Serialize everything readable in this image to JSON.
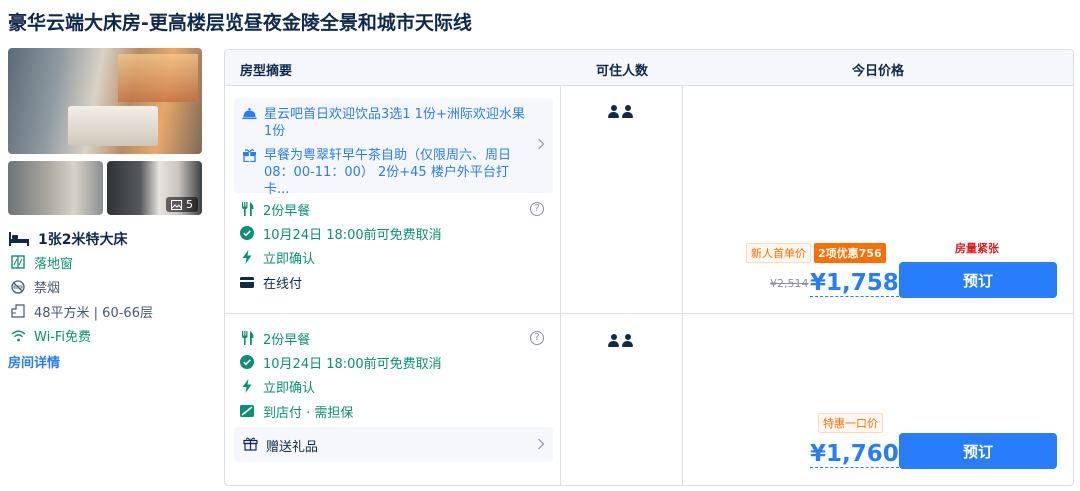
{
  "room": {
    "title": "豪华云端大床房-更高楼层览昼夜金陵全景和城市天际线",
    "photo_count": "5",
    "bed_type": "1张2米特大床",
    "facts": [
      {
        "icon": "window-icon",
        "text": "落地窗",
        "color": "#0a8f73"
      },
      {
        "icon": "no-smoking-icon",
        "text": "禁烟",
        "color": "#455873"
      },
      {
        "icon": "area-icon",
        "text": "48平方米 | 60-66层",
        "color": "#455873"
      },
      {
        "icon": "wifi-icon",
        "text": "Wi-Fi免费",
        "color": "#0a8f73"
      }
    ],
    "detail_link": "房间详情"
  },
  "table": {
    "headers": {
      "summary": "房型摘要",
      "guests": "可住人数",
      "price": "今日价格"
    }
  },
  "rate1": {
    "perks": [
      {
        "icon": "cloche-icon",
        "text": "星云吧首日欢迎饮品3选1 1份+洲际欢迎水果1份"
      },
      {
        "icon": "gift-icon",
        "text": "早餐为粤翠轩早午茶自助（仅限周六、周日08：00-11：00） 2份+45 楼户外平台打卡..."
      }
    ],
    "breakfast": "2份早餐",
    "cancel": "10月24日 18:00前可免费取消",
    "confirm": "立即确认",
    "payment": "在线付",
    "tag_new": "新人首单价",
    "tag_discount": "2项优惠756",
    "original_price": "¥2,514",
    "price": "¥1,758",
    "scarcity": "房量紧张",
    "book": "预订"
  },
  "rate2": {
    "breakfast": "2份早餐",
    "cancel": "10月24日 18:00前可免费取消",
    "confirm": "立即确认",
    "payment": "到店付 · 需担保",
    "gift": "赠送礼品",
    "tag": "特惠一口价",
    "price": "¥1,760",
    "book": "预订"
  },
  "colors": {
    "primary": "#287dfa",
    "green": "#0a8f73",
    "orange": "#ff6f00",
    "red": "#e21c1c",
    "text": "#0f294d"
  }
}
